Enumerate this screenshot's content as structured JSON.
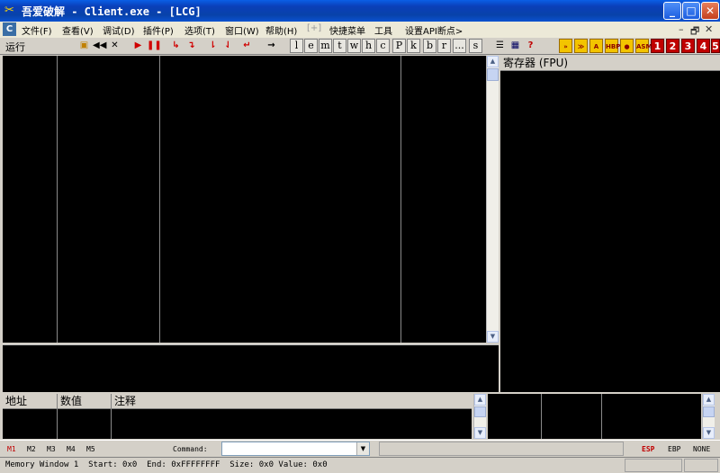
{
  "window": {
    "title": "吾爱破解 - Client.exe - [LCG]",
    "app_icon": "crossed-tools-icon",
    "controls": [
      "_",
      "□",
      "✕"
    ]
  },
  "menu": {
    "items": [
      {
        "label": "文件(F)",
        "enabled": true
      },
      {
        "label": "查看(V)",
        "enabled": true
      },
      {
        "label": "调试(D)",
        "enabled": true
      },
      {
        "label": "插件(P)",
        "enabled": true
      },
      {
        "label": "选项(T)",
        "enabled": true
      },
      {
        "label": "窗口(W)",
        "enabled": true
      },
      {
        "label": "帮助(H)",
        "enabled": true
      },
      {
        "label": "[+]",
        "enabled": false
      },
      {
        "label": "快捷菜单",
        "enabled": true
      },
      {
        "label": "工具",
        "enabled": true
      },
      {
        "label": "设置API断点>",
        "enabled": true
      }
    ],
    "mdi_controls": [
      "–",
      "🗗",
      "✕"
    ]
  },
  "toolbar": {
    "status": "运行",
    "letters": [
      "l",
      "e",
      "m",
      "t",
      "w",
      "h",
      "c",
      "P",
      "k",
      "b",
      "r",
      "...",
      "s"
    ],
    "plugins": [
      "»",
      "≫",
      "A",
      "HBP",
      "●",
      "ASM"
    ],
    "numbers": [
      "1",
      "2",
      "3",
      "4",
      "5"
    ],
    "help": "?"
  },
  "panes": {
    "registers_header": "寄存器 (FPU)",
    "dump_columns": [
      "地址",
      "数值",
      "注释"
    ]
  },
  "command_bar": {
    "memory_tabs": [
      "M1",
      "M2",
      "M3",
      "M4",
      "M5"
    ],
    "active_tab": "M1",
    "command_label": "Command:",
    "command_value": "",
    "registers": [
      "ESP",
      "EBP",
      "NONE"
    ],
    "active_register": "ESP"
  },
  "status_bar": {
    "text": "Memory Window 1  Start: 0x0  End: 0xFFFFFFFF  Size: 0x0 Value: 0x0"
  }
}
